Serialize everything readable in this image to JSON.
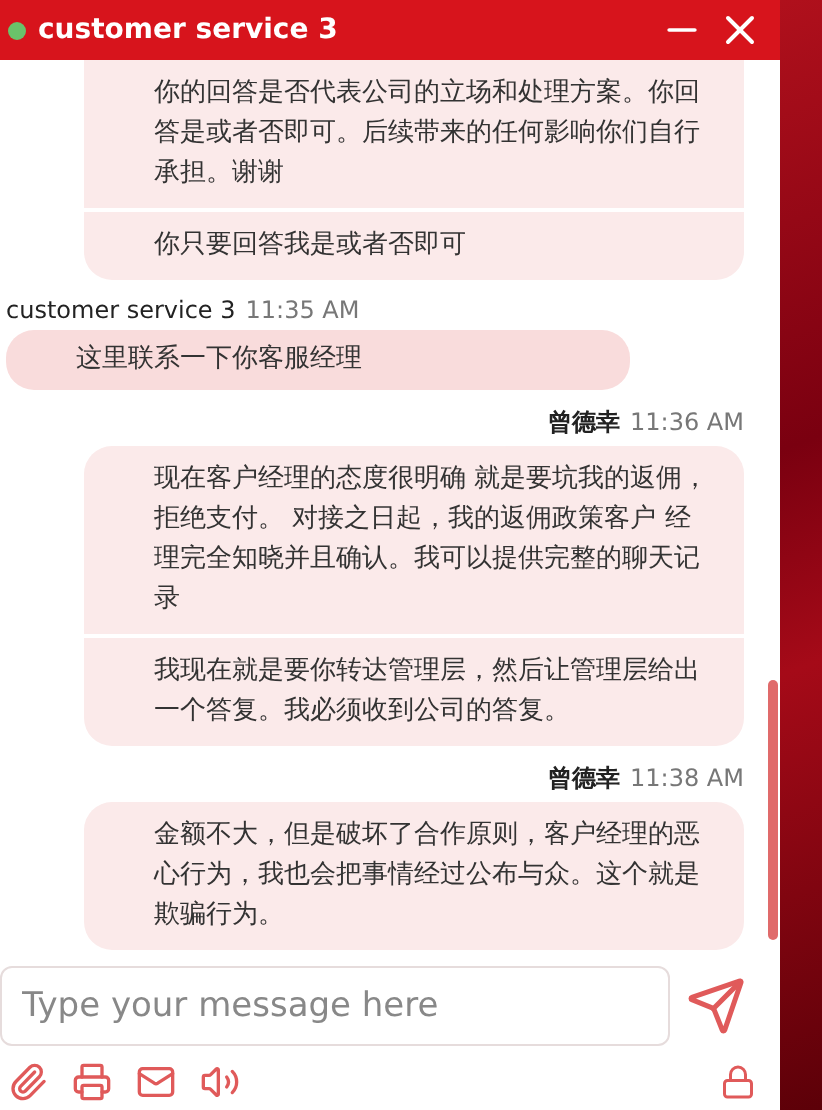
{
  "header": {
    "title": "customer service 3",
    "online": true
  },
  "messages": [
    {
      "kind": "outgoing",
      "parts": [
        "你的回答是否代表公司的立场和处理方案。你回答是或者否即可。后续带来的任何影响你们自行承担。谢谢",
        "你只要回答我是或者否即可"
      ]
    },
    {
      "kind": "incoming",
      "sender": "customer service 3",
      "time": "11:35 AM",
      "parts": [
        "这里联系一下你客服经理"
      ]
    },
    {
      "kind": "outgoing",
      "sender": "曾德幸",
      "time": "11:36 AM",
      "parts": [
        "现在客户经理的态度很明确 就是要坑我的返佣，拒绝支付。 对接之日起，我的返佣政策客户 经理完全知晓并且确认。我可以提供完整的聊天记录",
        "我现在就是要你转达管理层，然后让管理层给出一个答复。我必须收到公司的答复。"
      ]
    },
    {
      "kind": "outgoing",
      "sender": "曾德幸",
      "time": "11:38 AM",
      "parts": [
        "金额不大，但是破坏了合作原则，客户经理的恶心行为，我也会把事情经过公布与众。这个就是欺骗行为。"
      ]
    }
  ],
  "composer": {
    "placeholder": "Type your message here"
  }
}
